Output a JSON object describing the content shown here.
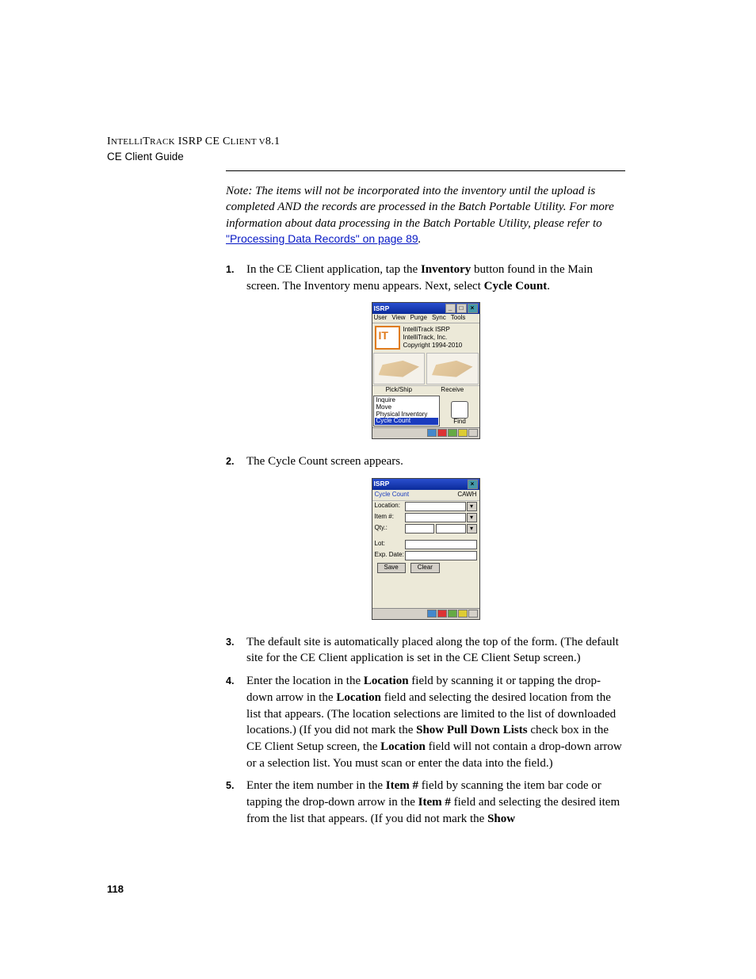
{
  "header": {
    "product": "IntelliTrack ISRP CE Client v8.1",
    "guide": "CE Client Guide"
  },
  "note": {
    "prefix": "Note:   ",
    "body": "The items will not be incorporated into the inventory until the upload is completed AND the records are processed in the Batch Portable Utility. For more information about data processing in the Batch Portable Utility, please refer to ",
    "link": "\"Processing Data Records\" on page 89",
    "suffix": "."
  },
  "steps": {
    "s1": {
      "num": "1.",
      "t1": "In the CE Client application, tap the ",
      "b1": "Inventory",
      "t2": " button found in the Main screen. The Inventory menu appears. Next, select ",
      "b2": "Cycle Count",
      "t3": "."
    },
    "s2": {
      "num": "2.",
      "t1": "The Cycle Count screen appears."
    },
    "s3": {
      "num": "3.",
      "t1": "The default site is automatically placed along the top of the form. (The default site for the CE Client application is set in the CE Client Setup screen.)"
    },
    "s4": {
      "num": "4.",
      "t1": "Enter the location in the ",
      "b1": "Location",
      "t2": " field by scanning it or tapping the drop-down arrow in the ",
      "b2": "Location",
      "t3": " field and selecting the desired location from the list that appears. (The location selections are limited to the list of downloaded locations.) (If you did not mark the ",
      "b3": "Show Pull Down Lists",
      "t4": " check box in the CE Client Setup screen, the ",
      "b4": "Location",
      "t5": " field will not contain a drop-down arrow or a selection list. You must scan or enter the data into the field.)"
    },
    "s5": {
      "num": "5.",
      "t1": "Enter the item number in the ",
      "b1": "Item #",
      "t2": " field by scanning the item bar code or tapping the drop-down arrow in the ",
      "b2": "Item #",
      "t3": " field and selecting the desired item from the list that appears. (If you did not mark the ",
      "b3": "Show"
    }
  },
  "fig1": {
    "title": "ISRP",
    "menu": {
      "m1": "User",
      "m2": "View",
      "m3": "Purge",
      "m4": "Sync",
      "m5": "Tools"
    },
    "about": {
      "l1": "IntelliTrack ISRP",
      "l2": "IntelliTrack, Inc.",
      "l3": "Copyright 1994-2010"
    },
    "btn": {
      "b1": "Pick/Ship",
      "b2": "Receive"
    },
    "sub": {
      "i1": "Inquire",
      "i2": "Move",
      "i3": "Physical Inventory",
      "sel": "Cycle Count",
      "find": "Find"
    }
  },
  "fig2": {
    "title": "ISRP",
    "head": {
      "l": "Cycle Count",
      "r": "CAWH"
    },
    "labels": {
      "loc": "Location:",
      "item": "Item #:",
      "qty": "Qty.:",
      "lot": "Lot:",
      "exp": "Exp. Date:"
    },
    "buttons": {
      "save": "Save",
      "clear": "Clear"
    }
  },
  "page_number": "118"
}
